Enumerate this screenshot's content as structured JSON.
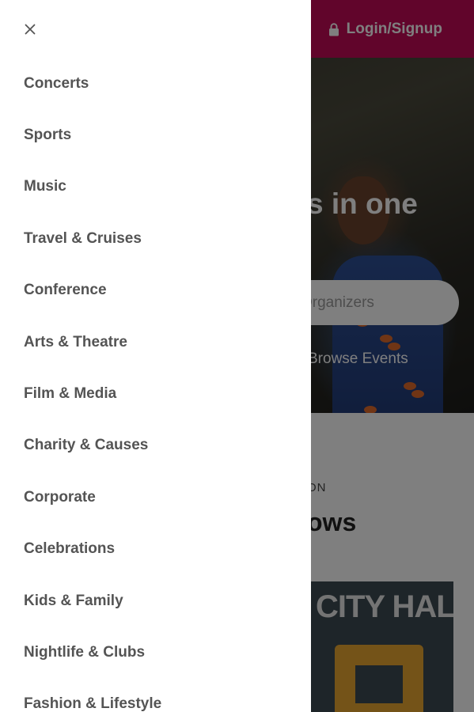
{
  "header": {
    "login_label": "Login/Signup",
    "lock_icon": "lock-icon",
    "brand_color": "#c20a57"
  },
  "hero": {
    "heading_fragment": "s in one",
    "search_placeholder_fragment": "Organizers",
    "browse_link_fragment": "Browse Events"
  },
  "section": {
    "eyebrow_fragment": "ON",
    "title_fragment": "ows",
    "card_text_fragment": "CITY HAL"
  },
  "drawer": {
    "close_icon": "close-icon",
    "items": [
      {
        "label": "Concerts"
      },
      {
        "label": "Sports"
      },
      {
        "label": "Music"
      },
      {
        "label": "Travel & Cruises"
      },
      {
        "label": "Conference"
      },
      {
        "label": "Arts & Theatre"
      },
      {
        "label": "Film & Media"
      },
      {
        "label": "Charity & Causes"
      },
      {
        "label": "Corporate"
      },
      {
        "label": "Celebrations"
      },
      {
        "label": "Kids & Family"
      },
      {
        "label": "Nightlife & Clubs"
      },
      {
        "label": "Fashion & Lifestyle"
      }
    ]
  }
}
